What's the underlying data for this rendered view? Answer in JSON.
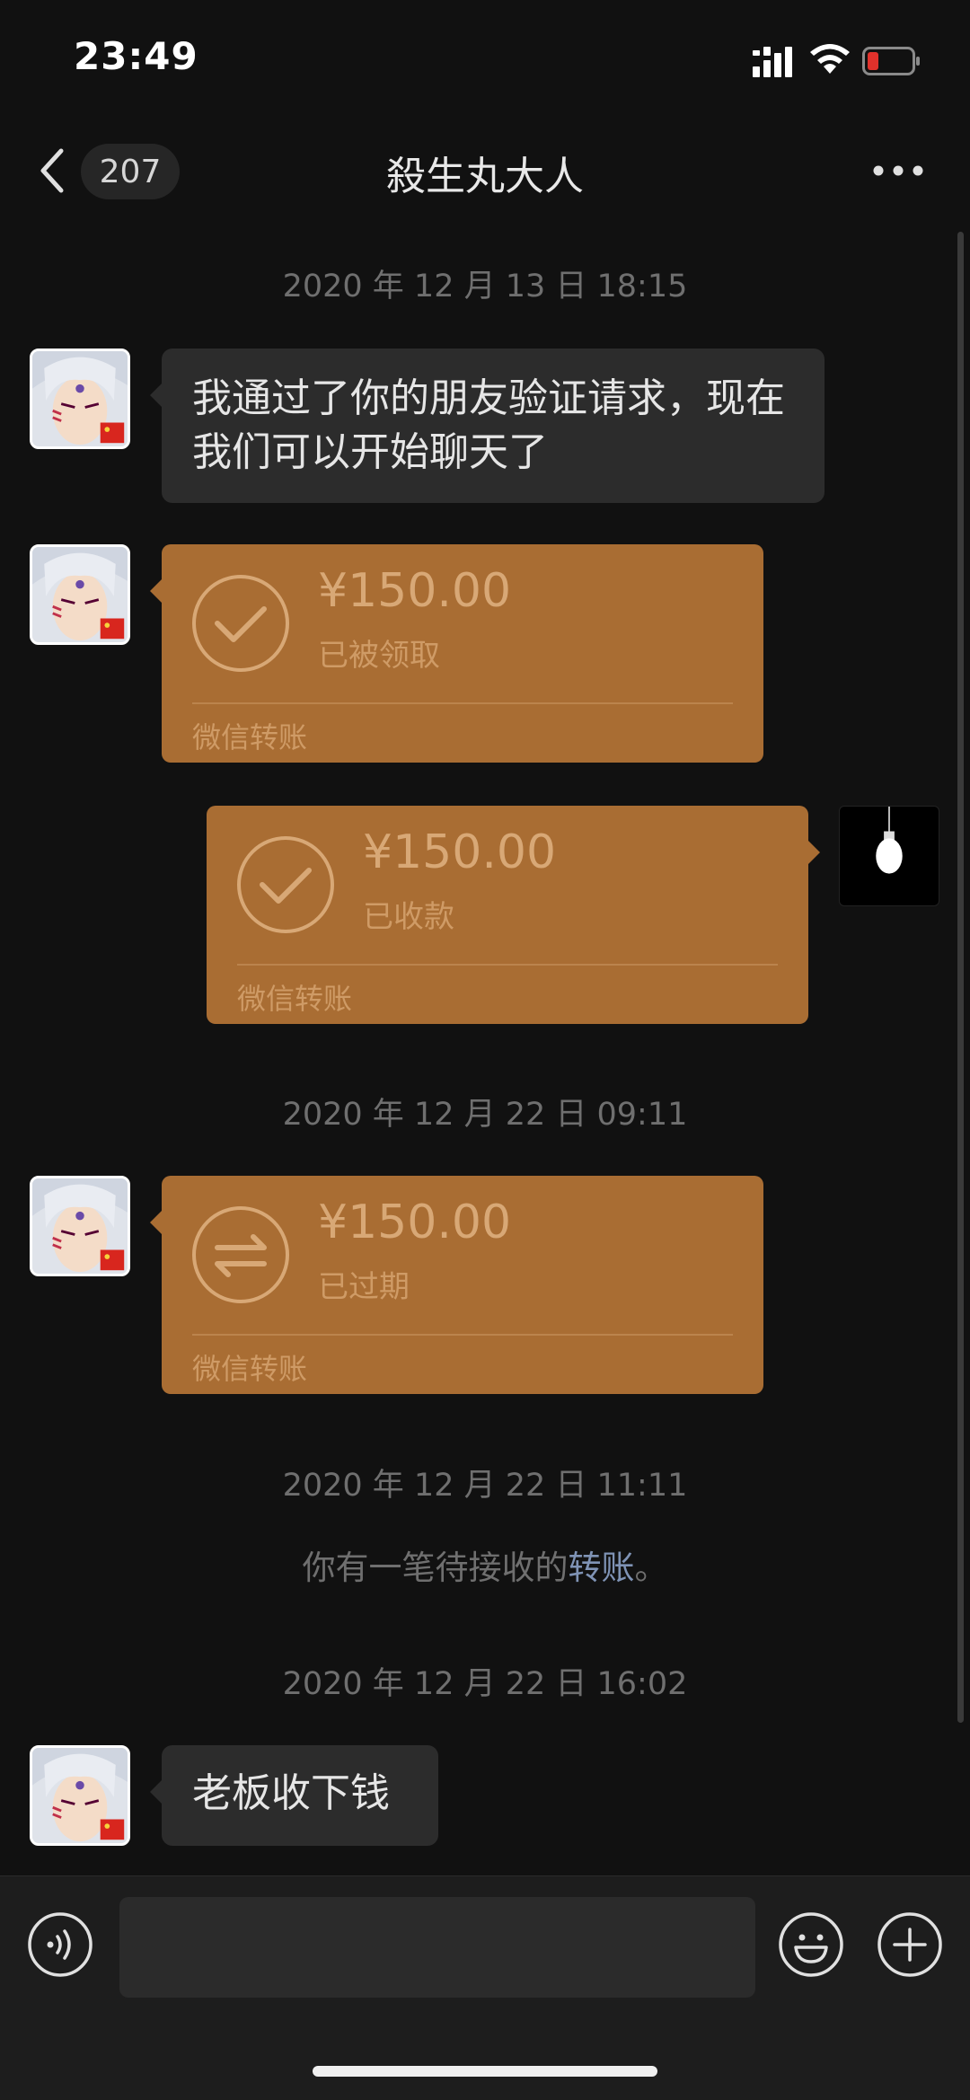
{
  "status_bar": {
    "time": "23:49",
    "battery_color": "#e0312b"
  },
  "nav": {
    "unread_count": "207",
    "title": "殺生丸大人"
  },
  "messages": {
    "t1": "2020 年 12 月 13 日 18:15",
    "m1": "我通过了你的朋友验证请求，现在我们可以开始聊天了",
    "card1": {
      "amount": "¥150.00",
      "status": "已被领取",
      "label": "微信转账"
    },
    "card2": {
      "amount": "¥150.00",
      "status": "已收款",
      "label": "微信转账"
    },
    "t2": "2020 年 12 月 22 日 09:11",
    "card3": {
      "amount": "¥150.00",
      "status": "已过期",
      "label": "微信转账"
    },
    "t3": "2020 年 12 月 22 日 11:11",
    "notice": {
      "before": "你有一笔待接收的",
      "link": "转账",
      "after": "。"
    },
    "t4": "2020 年 12 月 22 日 16:02",
    "m2": "老板收下钱"
  },
  "colors": {
    "card": "#a96d33",
    "bubble": "#2c2c2c",
    "link": "#7f93b5"
  },
  "icons": [
    "signal-icon",
    "wifi-icon",
    "battery-icon",
    "back-icon",
    "more-icon",
    "check-icon",
    "transfer-icon",
    "lightbulb-icon",
    "voice-icon",
    "emoji-icon",
    "plus-icon"
  ]
}
